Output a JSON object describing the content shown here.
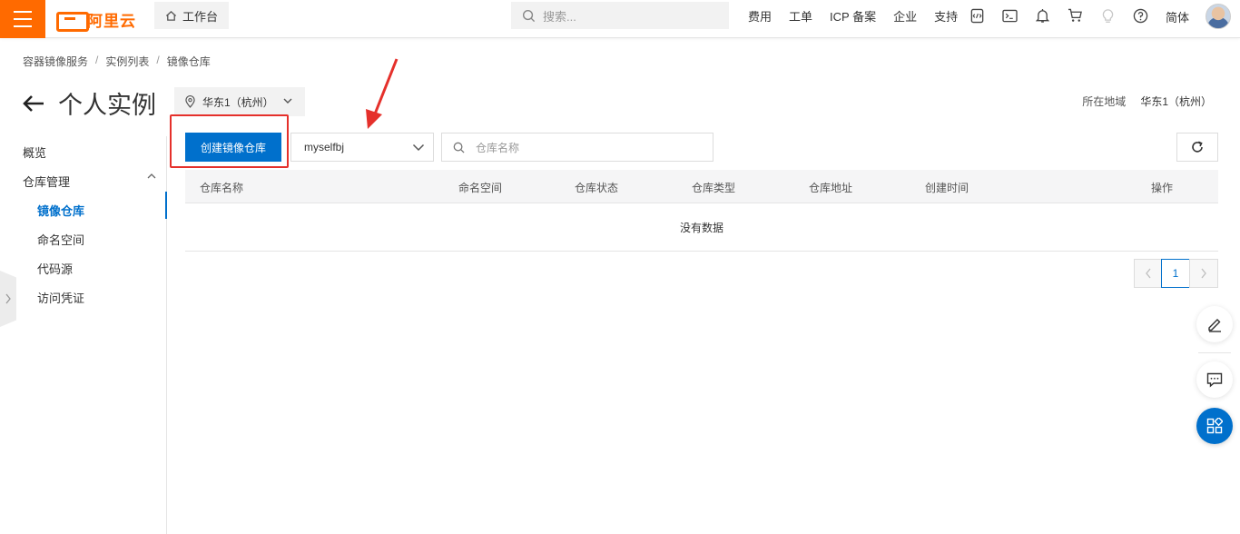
{
  "topbar": {
    "logo_text": "阿里云",
    "workbench_label": "工作台",
    "search_placeholder": "搜索...",
    "nav_links": [
      "费用",
      "工单",
      "ICP 备案",
      "企业",
      "支持"
    ],
    "nav_icons": [
      "ide-icon",
      "terminal-icon",
      "bell-icon",
      "cart-icon",
      "lightbulb-icon",
      "help-icon"
    ],
    "language": "简体"
  },
  "breadcrumb": [
    "容器镜像服务",
    "实例列表",
    "镜像仓库"
  ],
  "page": {
    "title": "个人实例",
    "region_select": "华东1（杭州）",
    "region_label": "所在地域",
    "region_value": "华东1（杭州）"
  },
  "sidebar": {
    "overview": "概览",
    "repo_management": "仓库管理",
    "items": [
      "镜像仓库",
      "命名空间",
      "代码源",
      "访问凭证"
    ],
    "active_index": 0
  },
  "toolbar": {
    "create_button": "创建镜像仓库",
    "namespace_value": "myselfbj",
    "search_placeholder": "仓库名称"
  },
  "table": {
    "columns": [
      "仓库名称",
      "命名空间",
      "仓库状态",
      "仓库类型",
      "仓库地址",
      "创建时间",
      "操作"
    ],
    "empty_text": "没有数据"
  },
  "pagination": {
    "current_page": "1"
  },
  "colors": {
    "brand_orange": "#ff6a00",
    "primary_blue": "#0070cc",
    "annotation_red": "#e5302b"
  }
}
